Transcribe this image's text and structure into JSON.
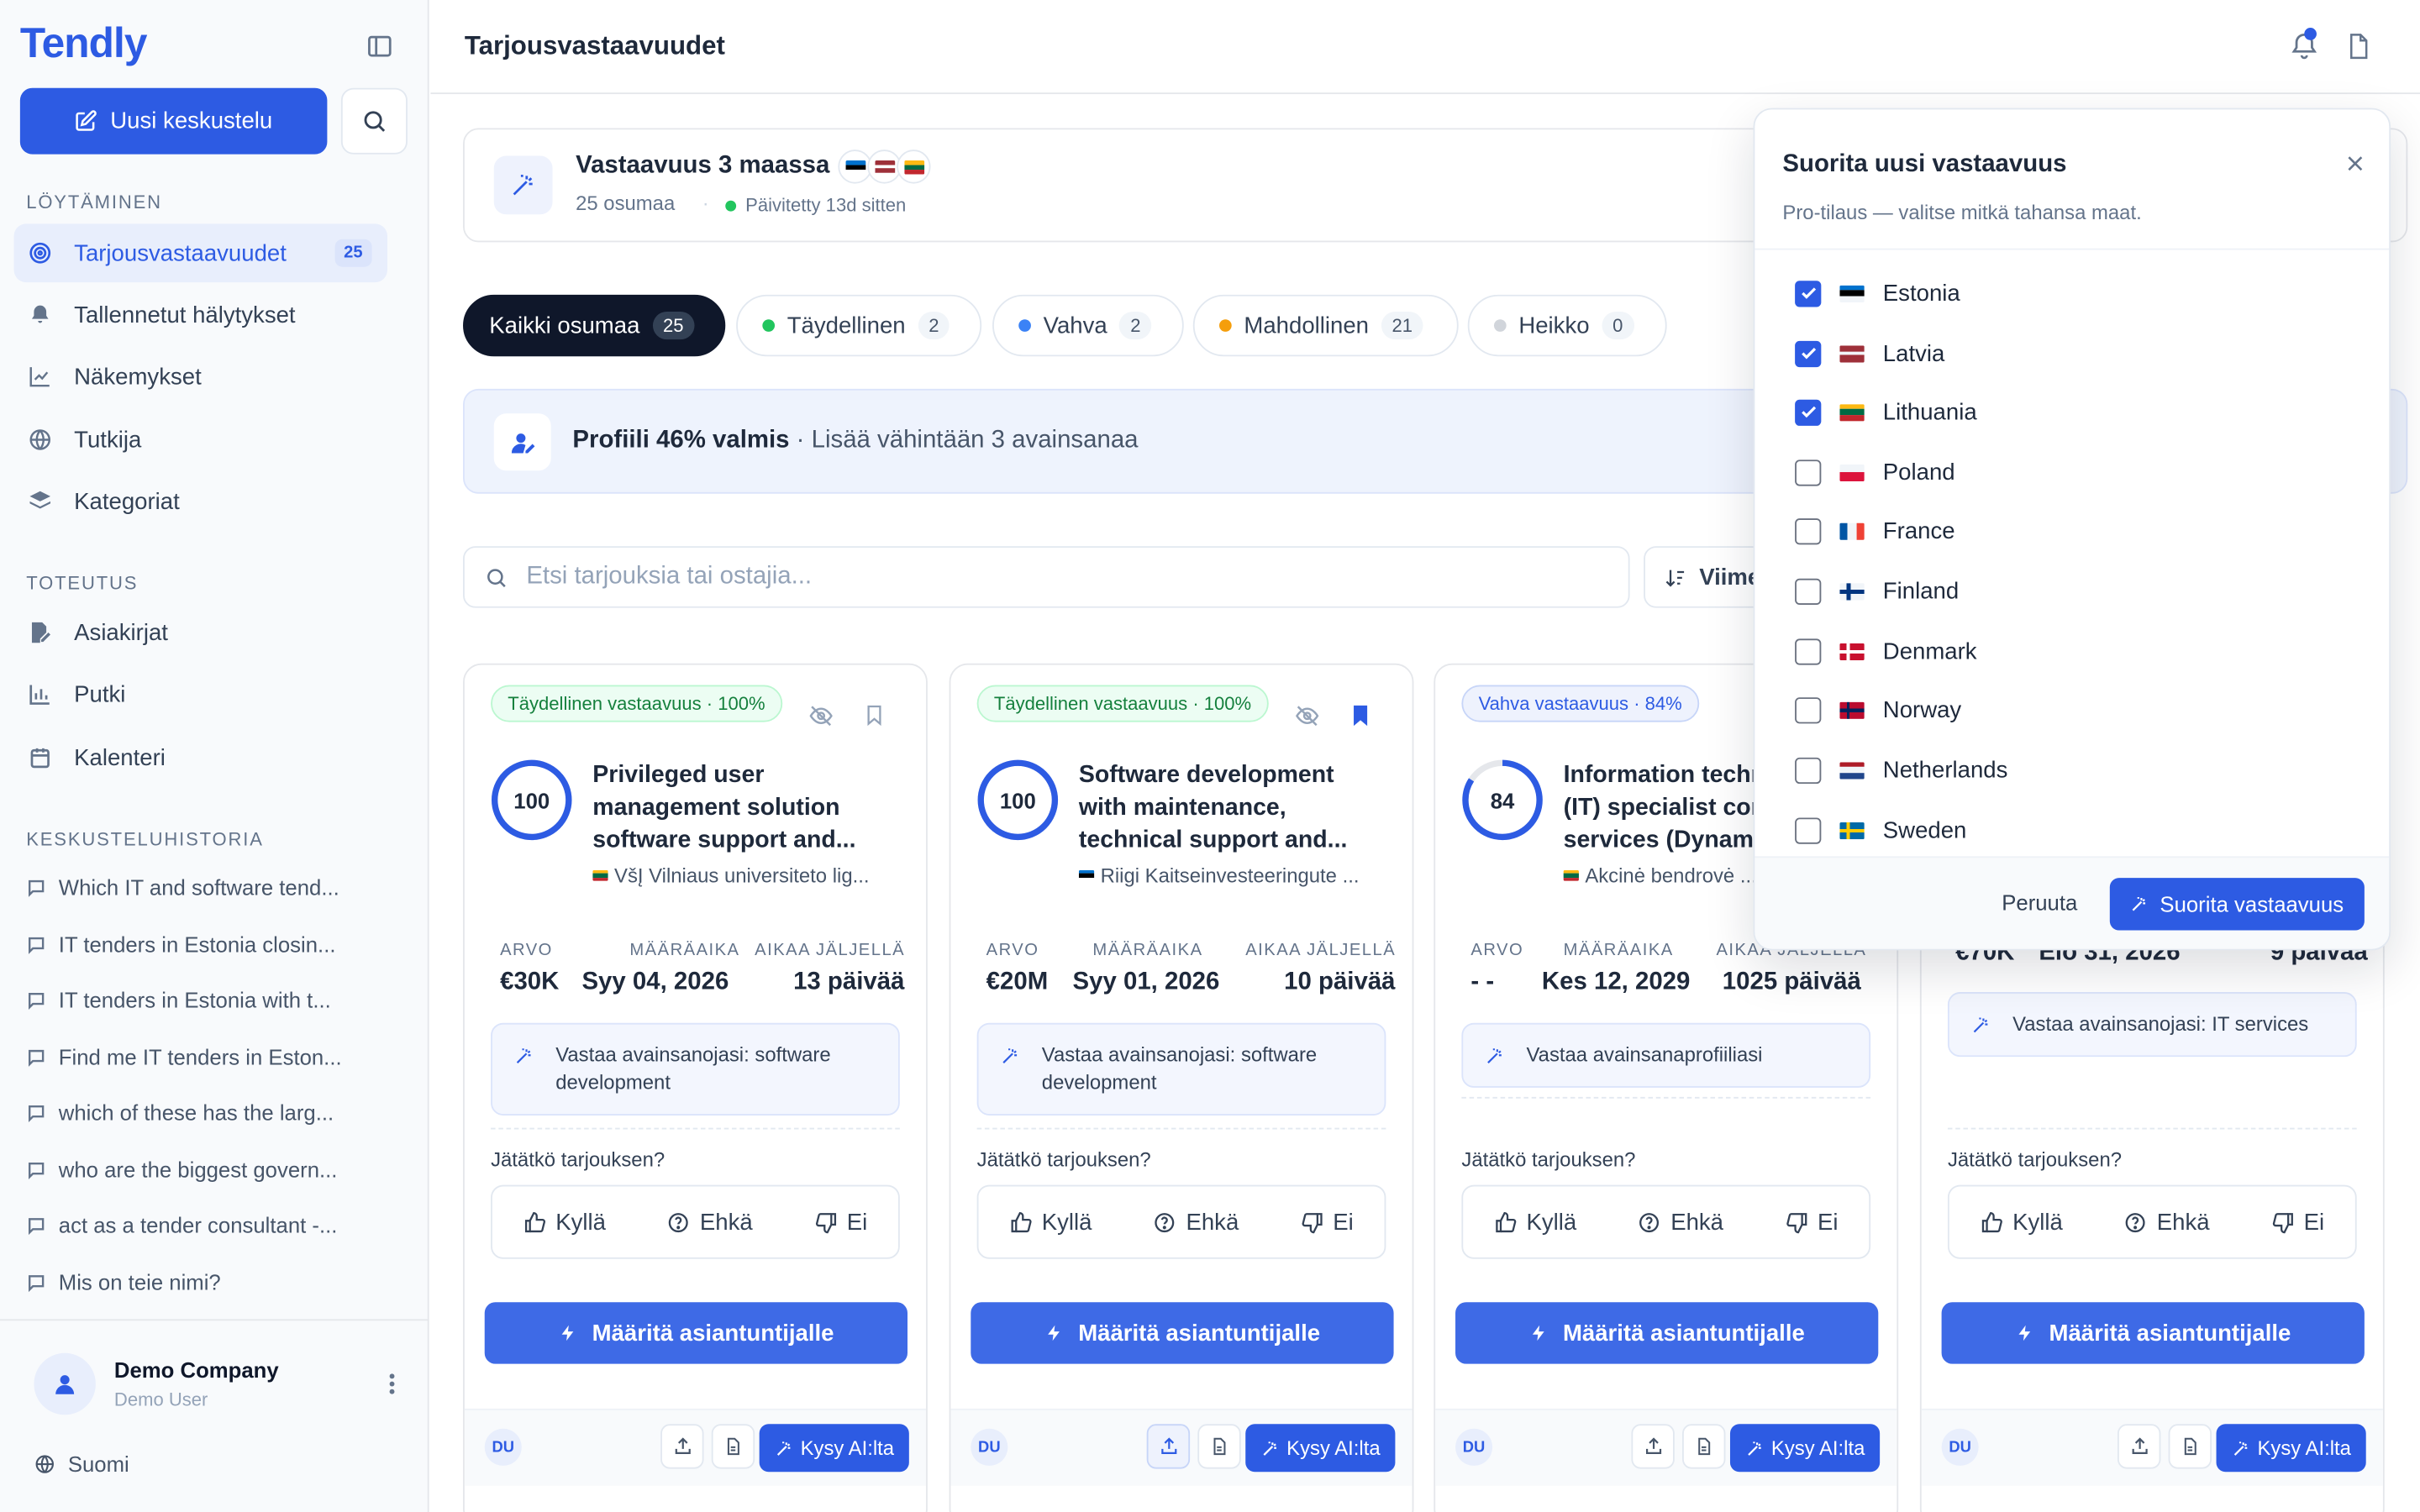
{
  "app": {
    "logo": "Tendly",
    "new_chat": "Uusi keskustelu"
  },
  "sidebar": {
    "section_discover": "LÖYTÄMINEN",
    "nav": [
      {
        "label": "Tarjousvastaavuudet",
        "badge": "25",
        "icon": "target-icon"
      },
      {
        "label": "Tallennetut hälytykset",
        "icon": "bell-icon"
      },
      {
        "label": "Näkemykset",
        "icon": "chart-line-icon"
      },
      {
        "label": "Tutkija",
        "icon": "globe-icon"
      },
      {
        "label": "Kategoriat",
        "icon": "layers-icon"
      }
    ],
    "section_exec": "TOTEUTUS",
    "nav2": [
      {
        "label": "Asiakirjat",
        "icon": "file-edit-icon"
      },
      {
        "label": "Putki",
        "icon": "bar-chart-icon"
      },
      {
        "label": "Kalenteri",
        "icon": "calendar-icon"
      }
    ],
    "section_history": "KESKUSTELUHISTORIA",
    "history": [
      "Which IT and software tend...",
      "IT tenders in Estonia closin...",
      "IT tenders in Estonia with t...",
      "Find me IT tenders in Eston...",
      "which of these has the larg...",
      "who are the biggest govern...",
      "act as a tender consultant -...",
      "Mis on teie nimi?"
    ],
    "company": "Demo Company",
    "user": "Demo User",
    "language": "Suomi"
  },
  "header": {
    "title": "Tarjousvastaavuudet"
  },
  "match": {
    "title": "Vastaavuus 3 maassa",
    "hits": "25 osumaa",
    "sep": "·",
    "updated": "Päivitetty 13d sitten"
  },
  "filters": [
    {
      "label": "Kaikki osumaa",
      "count": "25",
      "color": ""
    },
    {
      "label": "Täydellinen",
      "count": "2",
      "color": "#22c55e"
    },
    {
      "label": "Vahva",
      "count": "2",
      "color": "#3b82f6"
    },
    {
      "label": "Mahdollinen",
      "count": "21",
      "color": "#f59e0b"
    },
    {
      "label": "Heikko",
      "count": "0",
      "color": "#d1d5db"
    }
  ],
  "profile": {
    "bold": "Profiili 46% valmis",
    "rest": " · Lisää vähintään 3 avainsanaa"
  },
  "search": {
    "placeholder": "Etsi tarjouksia tai ostajia..."
  },
  "sort": {
    "label": "Viime"
  },
  "card_labels": {
    "value": "ARVO",
    "deadline": "MÄÄRÄAIKA",
    "left": "AIKAA JÄLJELLÄ",
    "question": "Jätätkö tarjouksen?",
    "yes": "Kyllä",
    "maybe": "Ehkä",
    "no": "Ei",
    "assign": "Määritä asiantuntijalle",
    "ask": "Kysy AI:lta",
    "initials": "DU"
  },
  "cards": [
    {
      "tag": "Täydellinen vastaavuus · 100%",
      "score": "100",
      "title": "Privileged user management solution software support and...",
      "buyer": "VšĮ Vilniaus universiteto lig...",
      "value": "€30K",
      "deadline": "Syy 04, 2026",
      "left": "13 päivää",
      "keywords": "Vastaa avainsanojasi: software development"
    },
    {
      "tag": "Täydellinen vastaavuus · 100%",
      "score": "100",
      "title": "Software development with maintenance, technical support and...",
      "buyer": "Riigi Kaitseinvesteeringute ...",
      "value": "€20M",
      "deadline": "Syy 01, 2026",
      "left": "10 päivää",
      "keywords": "Vastaa avainsanojasi: software development"
    },
    {
      "tag": "Vahva vastaavuus · 84%",
      "score": "84",
      "title": "Information technology (IT) specialist consulting services (Dynamics...",
      "buyer": "Akcinė bendrovė ...",
      "value": "- -",
      "deadline": "Kes 12, 2029",
      "left": "1025 päivää",
      "keywords": "Vastaa avainsanaprofiiliasi"
    },
    {
      "value": "€70K",
      "deadline": "Elo 31, 2026",
      "left": "9 päivää",
      "keywords": "Vastaa avainsanojasi: IT services"
    }
  ],
  "popup": {
    "title": "Suorita uusi vastaavuus",
    "subtitle": "Pro-tilaus — valitse mitkä tahansa maat.",
    "countries": [
      {
        "name": "Estonia",
        "checked": true
      },
      {
        "name": "Latvia",
        "checked": true
      },
      {
        "name": "Lithuania",
        "checked": true
      },
      {
        "name": "Poland",
        "checked": false
      },
      {
        "name": "France",
        "checked": false
      },
      {
        "name": "Finland",
        "checked": false
      },
      {
        "name": "Denmark",
        "checked": false
      },
      {
        "name": "Norway",
        "checked": false
      },
      {
        "name": "Netherlands",
        "checked": false
      },
      {
        "name": "Sweden",
        "checked": false
      }
    ],
    "cancel": "Peruuta",
    "run": "Suorita vastaavuus"
  },
  "colors": {
    "accent": "#2d5be3",
    "perfect": "#22c55e"
  }
}
